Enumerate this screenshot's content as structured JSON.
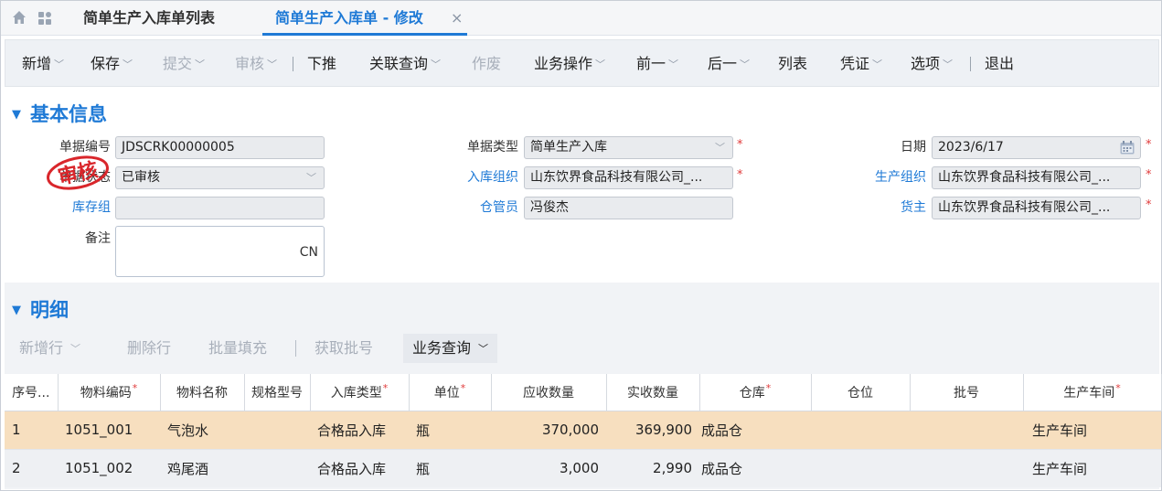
{
  "tabs": {
    "list_tab": "简单生产入库单列表",
    "edit_tab": "简单生产入库单 - 修改",
    "close_glyph": "×"
  },
  "toolbar": {
    "new": "新增",
    "save": "保存",
    "submit": "提交",
    "audit": "审核",
    "push_down": "下推",
    "related_query": "关联查询",
    "void": "作废",
    "business_ops": "业务操作",
    "prev": "前一",
    "next": "后一",
    "list": "列表",
    "voucher": "凭证",
    "options": "选项",
    "exit": "退出"
  },
  "basic_info": {
    "section_title": "基本信息",
    "bill_no_label": "单据编号",
    "bill_no": "JDSCRK00000005",
    "bill_type_label": "单据类型",
    "bill_type": "简单生产入库",
    "date_label": "日期",
    "date": "2023/6/17",
    "status_label": "单据状态",
    "status": "已审核",
    "stock_org_label": "入库组织",
    "stock_org": "山东饮界食品科技有限公司_...",
    "prd_org_label": "生产组织",
    "prd_org": "山东饮界食品科技有限公司_...",
    "stock_group_label": "库存组",
    "stock_group": "",
    "keeper_label": "仓管员",
    "keeper": "冯俊杰",
    "owner_label": "货主",
    "owner": "山东饮界食品科技有限公司_...",
    "memo_label": "备注",
    "memo_lang": "CN",
    "stamp_text": "审核"
  },
  "detail": {
    "section_title": "明细",
    "toolbar": {
      "add_row": "新增行",
      "delete_row": "删除行",
      "batch_fill": "批量填充",
      "get_lot": "获取批号",
      "biz_query": "业务查询"
    },
    "columns": {
      "seq": "序号...",
      "material_code": "物料编码",
      "material_name": "物料名称",
      "spec": "规格型号",
      "in_type": "入库类型",
      "unit": "单位",
      "must_qty": "应收数量",
      "real_qty": "实收数量",
      "stock": "仓库",
      "stock_loc": "仓位",
      "lot": "批号",
      "workshop": "生产车间"
    },
    "rows": [
      {
        "seq": "1",
        "material_code": "1051_001",
        "material_name": "气泡水",
        "spec": "",
        "in_type": "合格品入库",
        "unit": "瓶",
        "must_qty": "370,000",
        "real_qty": "369,900",
        "stock": "成品仓",
        "stock_loc": "",
        "lot": "",
        "workshop": "生产车间"
      },
      {
        "seq": "2",
        "material_code": "1051_002",
        "material_name": "鸡尾酒",
        "spec": "",
        "in_type": "合格品入库",
        "unit": "瓶",
        "must_qty": "3,000",
        "real_qty": "2,990",
        "stock": "成品仓",
        "stock_loc": "",
        "lot": "",
        "workshop": "生产车间"
      }
    ]
  },
  "colors": {
    "accent": "#1f7ad6",
    "required": "#e03a3a",
    "selected_row": "#f7dfbf",
    "stamp": "#d9262b"
  }
}
